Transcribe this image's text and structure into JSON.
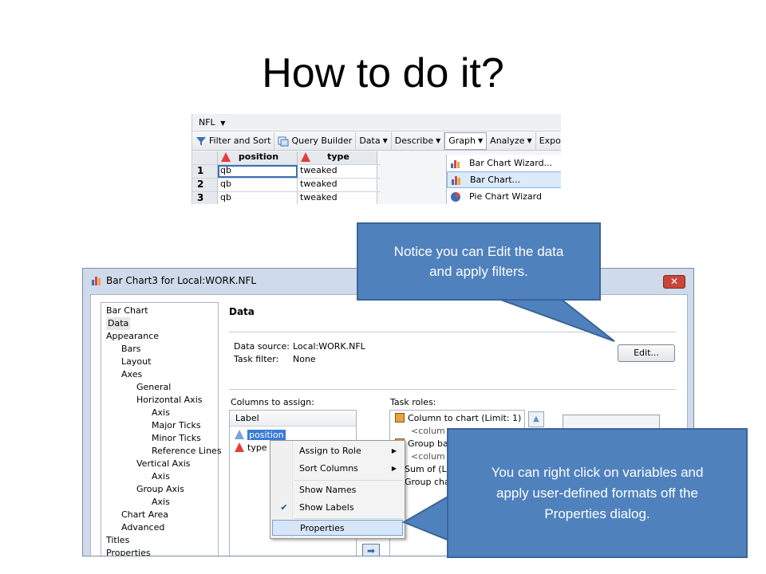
{
  "slide": {
    "title": "How to do it?"
  },
  "top_screenshot": {
    "dataset_menu": "NFL",
    "toolbar": [
      {
        "label": "Filter and Sort",
        "icon": "filter-icon",
        "dropdown": false
      },
      {
        "label": "Query Builder",
        "icon": "query-builder-icon",
        "dropdown": false
      },
      {
        "label": "Data",
        "dropdown": true
      },
      {
        "label": "Describe",
        "dropdown": true
      },
      {
        "label": "Graph",
        "dropdown": true,
        "active": true
      },
      {
        "label": "Analyze",
        "dropdown": true
      },
      {
        "label": "Expo",
        "dropdown": false
      }
    ],
    "grid": {
      "columns": [
        "position",
        "type"
      ],
      "rows": [
        {
          "num": "1",
          "position": "qb",
          "type": "tweaked"
        },
        {
          "num": "2",
          "position": "qb",
          "type": "tweaked"
        },
        {
          "num": "3",
          "position": "qb",
          "type": "tweaked"
        }
      ]
    },
    "graph_menu": [
      {
        "label": "Bar Chart Wizard...",
        "icon": "bar-chart-wizard-icon"
      },
      {
        "label": "Bar Chart...",
        "icon": "bar-chart-icon",
        "highlighted": true
      },
      {
        "label": "Pie Chart Wizard",
        "icon": "pie-chart-icon"
      }
    ]
  },
  "dialog": {
    "title": "Bar Chart3 for Local:WORK.NFL",
    "close_label": "✕",
    "tree": [
      {
        "label": "Bar Chart",
        "indent": 0
      },
      {
        "label": "Data",
        "indent": 0,
        "selected": true
      },
      {
        "label": "Appearance",
        "indent": 0
      },
      {
        "label": "Bars",
        "indent": 1
      },
      {
        "label": "Layout",
        "indent": 1
      },
      {
        "label": "Axes",
        "indent": 1
      },
      {
        "label": "General",
        "indent": 2
      },
      {
        "label": "Horizontal Axis",
        "indent": 2
      },
      {
        "label": "Axis",
        "indent": 3
      },
      {
        "label": "Major Ticks",
        "indent": 3
      },
      {
        "label": "Minor Ticks",
        "indent": 3
      },
      {
        "label": "Reference Lines",
        "indent": 3
      },
      {
        "label": "Vertical Axis",
        "indent": 2
      },
      {
        "label": "Axis",
        "indent": 3
      },
      {
        "label": "Group Axis",
        "indent": 2
      },
      {
        "label": "Axis",
        "indent": 3
      },
      {
        "label": "Chart Area",
        "indent": 1
      },
      {
        "label": "Advanced",
        "indent": 1
      },
      {
        "label": "Titles",
        "indent": 0
      },
      {
        "label": "Properties",
        "indent": 0
      }
    ],
    "panel": {
      "heading": "Data",
      "data_source_label": "Data source:",
      "data_source_value": "Local:WORK.NFL",
      "task_filter_label": "Task filter:",
      "task_filter_value": "None",
      "edit_button": "Edit...",
      "columns_label": "Columns to assign:",
      "columns_header": "Label",
      "columns": [
        "position",
        "type"
      ],
      "task_roles_label": "Task roles:",
      "task_roles": [
        "Column to chart  (Limit: 1)",
        "<colum",
        "Group bars",
        "<colum",
        "Sum of  (Lin",
        "Group char"
      ]
    },
    "context_menu": [
      {
        "label": "Assign to Role",
        "submenu": true
      },
      {
        "label": "Sort Columns",
        "submenu": true
      },
      {
        "label": "Show Names"
      },
      {
        "label": "Show Labels",
        "checked": true
      },
      {
        "label": "Properties",
        "highlighted": true
      }
    ]
  },
  "callouts": {
    "top": "Notice you can Edit the data\nand apply filters.",
    "bottom": "You can right click on variables and\napply user-defined formats off the\nProperties dialog."
  },
  "colors": {
    "callout_fill": "#4f81bd",
    "selection_blue": "#3a7cd6",
    "warning_red": "#e43b3b"
  }
}
